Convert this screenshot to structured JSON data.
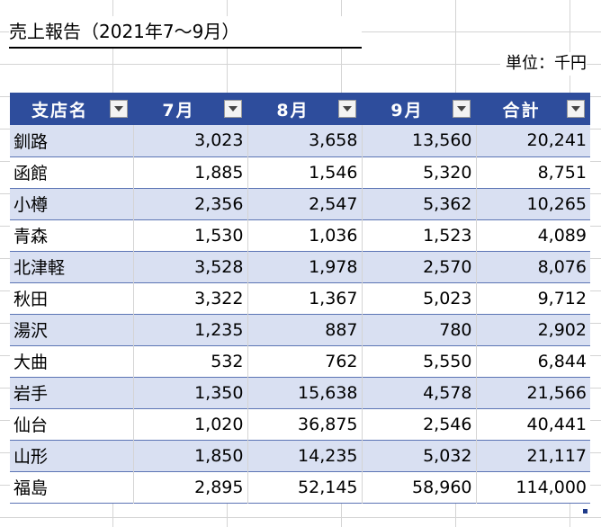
{
  "title": "売上報告（2021年7～9月）",
  "unit": "単位：千円",
  "table": {
    "headers": [
      "支店名",
      "7月",
      "8月",
      "9月",
      "合計"
    ],
    "rows": [
      [
        "釧路",
        "3,023",
        "3,658",
        "13,560",
        "20,241"
      ],
      [
        "函館",
        "1,885",
        "1,546",
        "5,320",
        "8,751"
      ],
      [
        "小樽",
        "2,356",
        "2,547",
        "5,362",
        "10,265"
      ],
      [
        "青森",
        "1,530",
        "1,036",
        "1,523",
        "4,089"
      ],
      [
        "北津軽",
        "3,528",
        "1,978",
        "2,570",
        "8,076"
      ],
      [
        "秋田",
        "3,322",
        "1,367",
        "5,023",
        "9,712"
      ],
      [
        "湯沢",
        "1,235",
        "887",
        "780",
        "2,902"
      ],
      [
        "大曲",
        "532",
        "762",
        "5,550",
        "6,844"
      ],
      [
        "岩手",
        "1,350",
        "15,638",
        "4,578",
        "21,566"
      ],
      [
        "仙台",
        "1,020",
        "36,875",
        "2,546",
        "40,441"
      ],
      [
        "山形",
        "1,850",
        "14,235",
        "5,032",
        "21,117"
      ],
      [
        "福島",
        "2,895",
        "52,145",
        "58,960",
        "114,000"
      ]
    ]
  },
  "icons": {
    "filter": "dropdown-arrow-icon"
  },
  "colors": {
    "header_bg": "#2e4d9c",
    "band_bg": "#d9e0f2",
    "row_border": "#5b74b4"
  }
}
